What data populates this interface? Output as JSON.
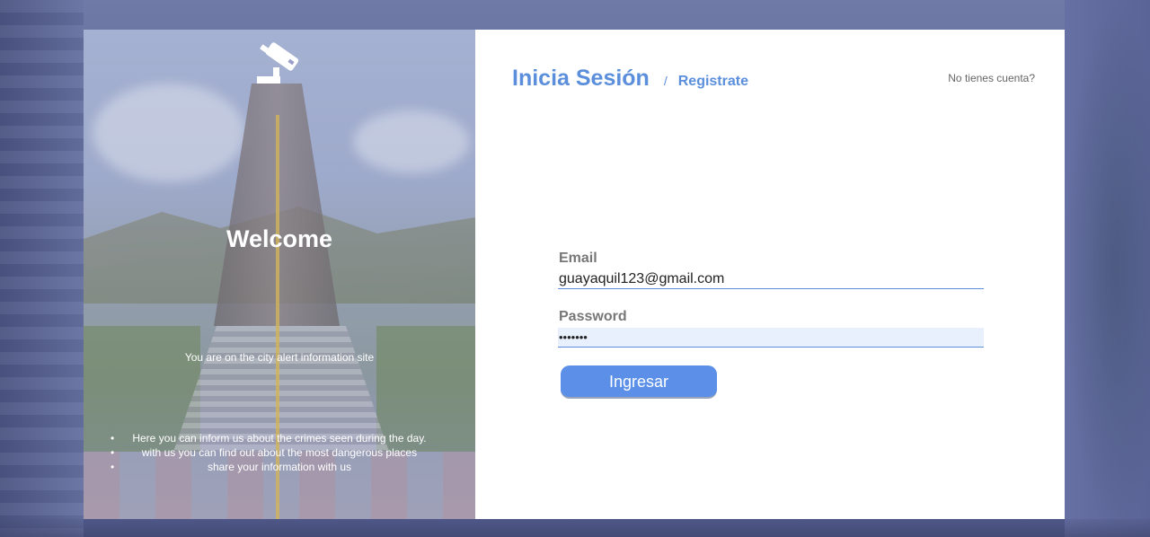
{
  "brand": {
    "accent": "#5b8fdc",
    "button_color": "#5b8fe8",
    "overlay_color": "#9aa0c8"
  },
  "left_panel": {
    "icon": "security-camera-icon",
    "welcome": "Welcome",
    "subtitle": "You are on the city alert information site",
    "features": [
      "Here you can inform us about the crimes seen during the day.",
      "with us you can find out about the most dangerous places",
      "share your information with us"
    ]
  },
  "header": {
    "login_title": "Inicia Sesión",
    "separator": "/",
    "register_link": "Registrate",
    "no_account": "No tienes cuenta?"
  },
  "form": {
    "email_label": "Email",
    "email_value": "guayaquil123@gmail.com",
    "password_label": "Password",
    "password_value": "•••••••",
    "submit_label": "Ingresar"
  }
}
